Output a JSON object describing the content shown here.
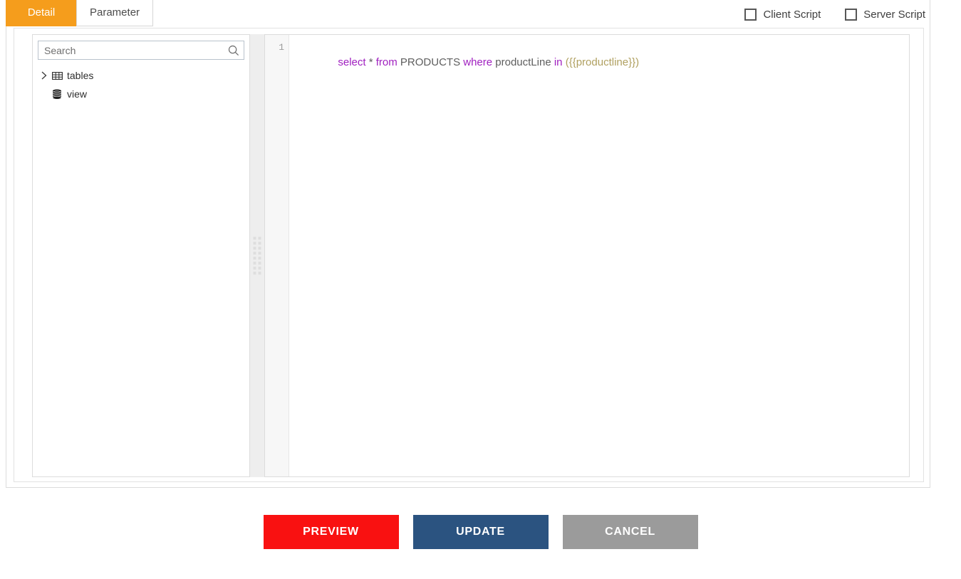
{
  "tabs": [
    {
      "label": "Detail",
      "active": true,
      "name": "tab-detail"
    },
    {
      "label": "Parameter",
      "active": false,
      "name": "tab-parameter"
    }
  ],
  "script_options": [
    {
      "label": "Client Script",
      "checked": false
    },
    {
      "label": "Server Script",
      "checked": false
    }
  ],
  "tree_panel": {
    "search": {
      "placeholder": "Search",
      "value": "",
      "icon": "search-icon"
    },
    "nodes": [
      {
        "label": "tables",
        "icon": "table-grid-icon",
        "expander": "chevron-right-icon",
        "expanded": false
      },
      {
        "label": "view",
        "icon": "database-icon",
        "expander": "",
        "expanded": false
      }
    ]
  },
  "editor": {
    "line_numbers": [
      "1"
    ],
    "lines": [
      {
        "tokens": [
          {
            "text": "select",
            "type": "keyword"
          },
          {
            "text": " * ",
            "type": "plain"
          },
          {
            "text": "from",
            "type": "keyword"
          },
          {
            "text": " PRODUCTS ",
            "type": "plain"
          },
          {
            "text": "where",
            "type": "keyword"
          },
          {
            "text": " productLine ",
            "type": "plain"
          },
          {
            "text": "in",
            "type": "keyword"
          },
          {
            "text": " ",
            "type": "plain"
          },
          {
            "text": "({{productline}})",
            "type": "var"
          }
        ]
      }
    ],
    "raw_sql": "select * from PRODUCTS where productLine in ({{productline}})"
  },
  "splitter": {
    "name": "pane-splitter",
    "grip_dots": 16
  },
  "footer": {
    "buttons": [
      {
        "label": "PREVIEW",
        "name": "preview-button",
        "color": "#f91111"
      },
      {
        "label": "UPDATE",
        "name": "update-button",
        "color": "#2b5380"
      },
      {
        "label": "CANCEL",
        "name": "cancel-button",
        "color": "#9b9b9b"
      }
    ]
  },
  "colors": {
    "accent_orange": "#f59d1c",
    "preview_red": "#f91111",
    "update_blue": "#2b5380",
    "cancel_gray": "#9b9b9b",
    "keyword_purple": "#a020c0",
    "variable_olive": "#b0a060"
  }
}
